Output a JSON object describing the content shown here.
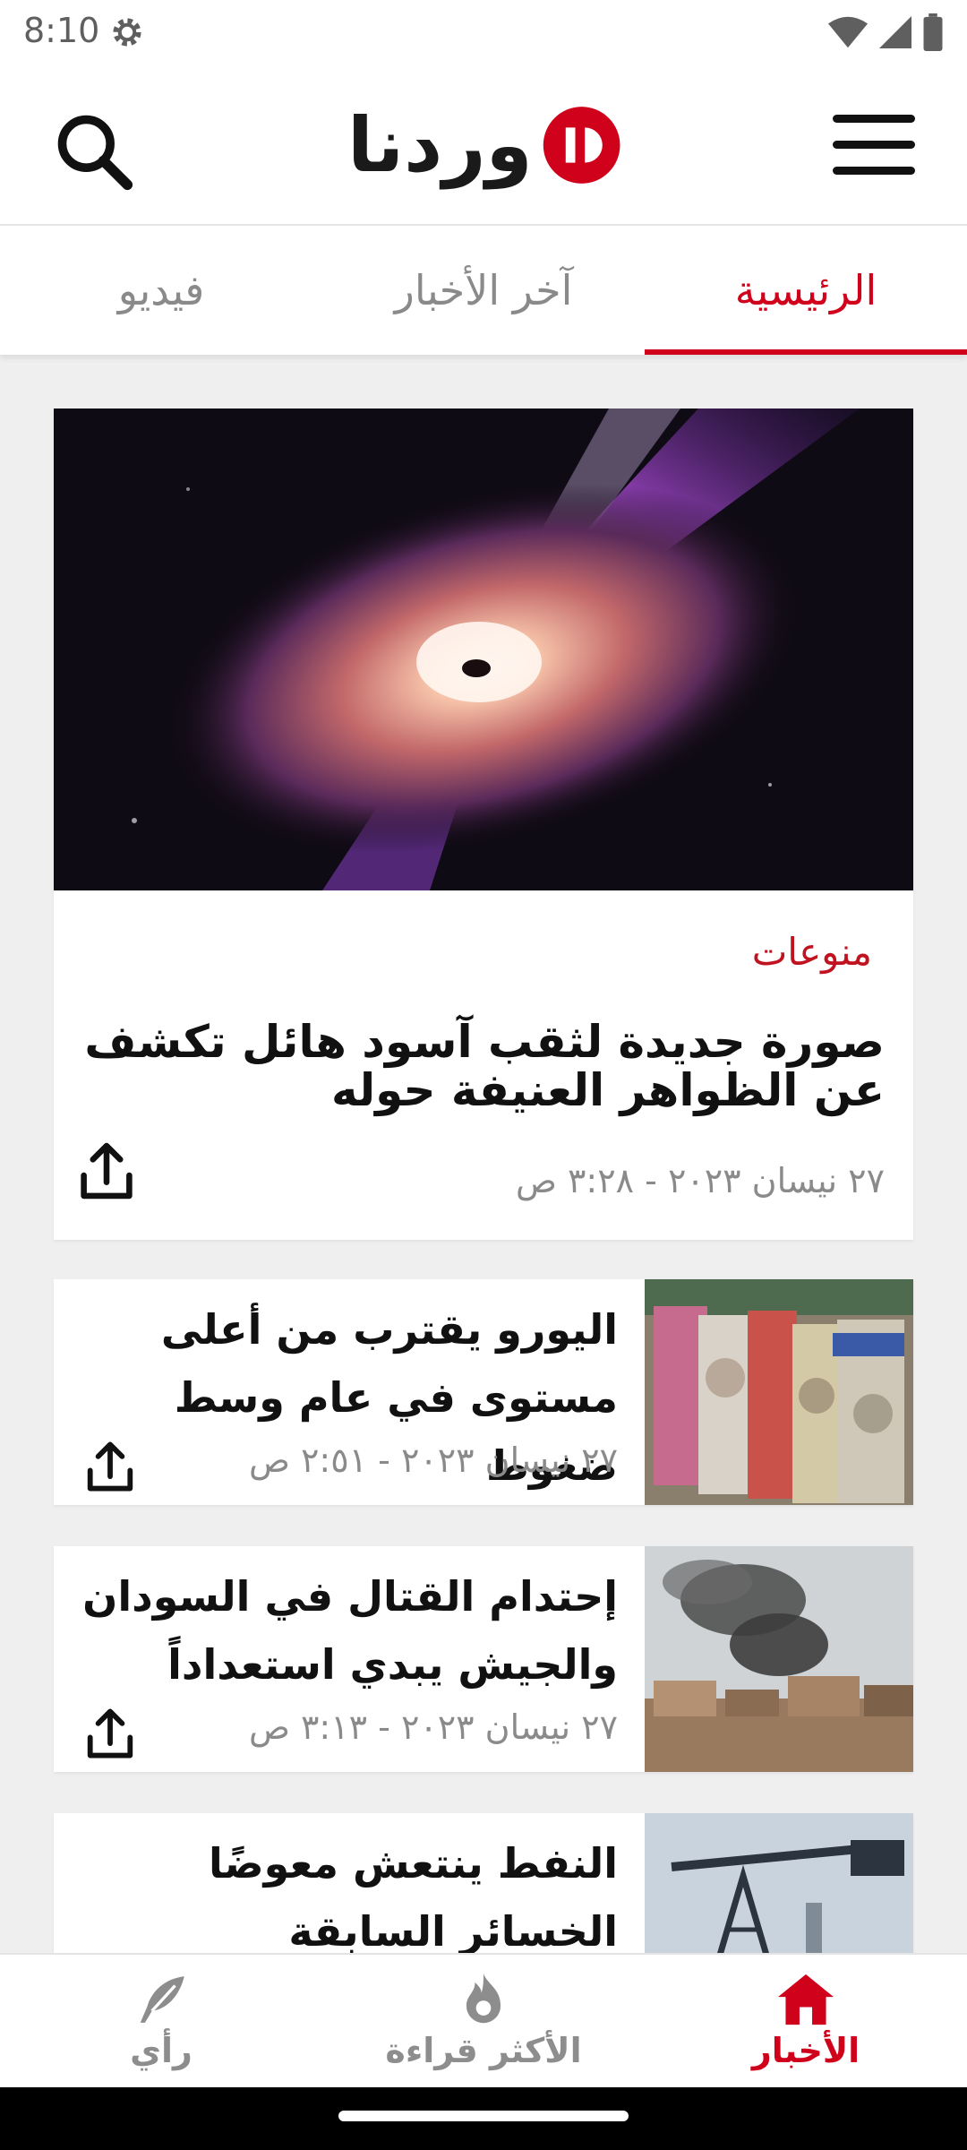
{
  "status_bar": {
    "time": "8:10",
    "icons": [
      "gear-icon",
      "wifi-icon",
      "cell-signal-icon",
      "battery-icon"
    ]
  },
  "header": {
    "logo_text": "وردنا",
    "icons": [
      "menu-icon",
      "search-icon"
    ],
    "brand_color": "#d0021b"
  },
  "tabs": [
    {
      "label": "الرئيسية",
      "active": true
    },
    {
      "label": "آخر الأخبار",
      "active": false
    },
    {
      "label": "فيديو",
      "active": false
    }
  ],
  "featured": {
    "category": "منوعات",
    "title": "صورة جديدة لثقب آسود هائل تكشف عن الظواهر العنيفة حوله",
    "date": "٢٧ نيسان ٢٠٢٣ - ٣:٢٨ ص",
    "image": "black-hole-illustration"
  },
  "articles": [
    {
      "title": "اليورو يقترب من أعلى مستوى في عام وسط ضغوط",
      "date": "٢٧ نيسان ٢٠٢٣ - ٢:٥١ ص",
      "image": "banknotes-photo"
    },
    {
      "title": "إحتدام القتال في السودان والجيش يبدي استعداداً",
      "date": "٢٧ نيسان ٢٠٢٣ - ٣:١٣ ص",
      "image": "smoke-over-city-photo"
    },
    {
      "title": "النفط ينتعش معوضًا الخسائر السابقة",
      "date": "",
      "image": "oil-pump-photo"
    }
  ],
  "bottom_nav": [
    {
      "label": "الأخبار",
      "icon": "home-icon",
      "active": true
    },
    {
      "label": "الأكثر قراءة",
      "icon": "flame-icon",
      "active": false
    },
    {
      "label": "رأي",
      "icon": "feather-icon",
      "active": false
    }
  ]
}
